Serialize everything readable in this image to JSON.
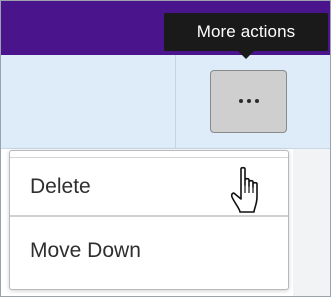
{
  "tooltip": {
    "text": "More actions"
  },
  "more_button": {
    "icon": "more-horizontal-icon"
  },
  "menu": {
    "items": [
      {
        "label": "Delete"
      },
      {
        "label": "Move Down"
      }
    ]
  },
  "cursor": {
    "icon": "hand-pointer-icon"
  },
  "colors": {
    "header": "#4a148c",
    "row_highlight": "#deebf9",
    "tooltip_bg": "#1a1a1a",
    "button_bg": "#cfcfcf"
  }
}
